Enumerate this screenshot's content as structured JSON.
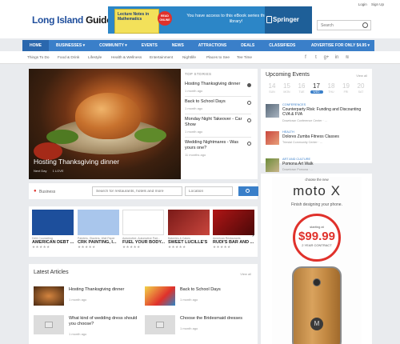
{
  "site": {
    "logo_part1": "Long Island",
    "logo_part2": "Guide"
  },
  "top_links": {
    "login": "Login",
    "signup": "Sign Up"
  },
  "banner": {
    "book_title": "Lecture Notes in Mathematics",
    "badge": "READ ONLINE",
    "message": "You have access to this eBook series through your library!",
    "brand": "Springer"
  },
  "search": {
    "placeholder": "Search"
  },
  "nav": {
    "items": [
      "HOME",
      "BUSINESSES ▾",
      "COMMUNITY ▾",
      "EVENTS",
      "NEWS",
      "ATTRACTIONS",
      "DEALS",
      "CLASSIFIEDS"
    ],
    "right": "ADVERTISE FOR ONLY $4.95 ▾"
  },
  "subnav": {
    "items": [
      "Things To Do",
      "Food & Drink",
      "Lifestyle",
      "Health & Wellness",
      "Entertainment",
      "Nightlife",
      "Places to See",
      "Tee Time"
    ]
  },
  "social": {
    "icons": [
      "f",
      "t",
      "g+",
      "in",
      "rss"
    ]
  },
  "hero": {
    "caption": "Hosting Thanksgiving dinner",
    "meta_date": "Next Day",
    "meta_views": "1 LOVE",
    "stories_label": "TOP STORIES",
    "stories": [
      {
        "title": "Hosting Thanksgiving dinner",
        "date": "1 month ago"
      },
      {
        "title": "Back to School Days",
        "date": "1 month ago"
      },
      {
        "title": "Monday Night Takeover - Car Show",
        "date": "1 month ago"
      },
      {
        "title": "Wedding Nightmares - Was yours one?",
        "date": "11 months ago"
      }
    ]
  },
  "events": {
    "heading": "Upcoming Events",
    "view_all": "View all",
    "dates": [
      {
        "day": "14",
        "wd": "SUN"
      },
      {
        "day": "15",
        "wd": "MON"
      },
      {
        "day": "16",
        "wd": "TUE"
      },
      {
        "day": "17",
        "wd": "WED"
      },
      {
        "day": "18",
        "wd": "THU"
      },
      {
        "day": "19",
        "wd": "FRI"
      },
      {
        "day": "20",
        "wd": "SAT"
      }
    ],
    "items": [
      {
        "category": "CONFERENCES",
        "name": "Counterparty Risk: Funding and Discounting CVA & FVA",
        "location": "Downtown Conference Center · ..."
      },
      {
        "category": "HEALTH",
        "name": "Dolores Zumba Fitness Classes",
        "location": "Triestal Community Center · ..."
      },
      {
        "category": "ART AND CULTURE",
        "name": "Pomona Art Walk",
        "location": "Downtown Pomona · ..."
      }
    ]
  },
  "finder": {
    "label": "Business",
    "query_placeholder": "Search for restaurants, hotels and more",
    "location_placeholder": "Location"
  },
  "businesses": [
    {
      "category": "Debt Counseling",
      "name": "AMERICAN DEBT ...",
      "stars": "★★★★★"
    },
    {
      "category": "Painters, Glaziers, Wall Paper",
      "name": "CRK PAINTING, I...",
      "stars": "★★★★★"
    },
    {
      "category": "Automotive, Automotive Part...",
      "name": "FUEL YOUR BODY...",
      "stars": "★★★★★"
    },
    {
      "category": "Bakeries & Cakes",
      "name": "SWEET LUCILLE'S",
      "stars": "★★★★★"
    },
    {
      "category": "American Restaurants",
      "name": "RUDI'S BAR AND ...",
      "stars": "★★★★★"
    }
  ],
  "latest": {
    "heading": "Latest Articles",
    "view_all": "View all",
    "articles": [
      {
        "title": "Hosting Thanksgiving dinner",
        "date": "1 month ago"
      },
      {
        "title": "Back to School Days",
        "date": "1 month ago"
      },
      {
        "title": "What kind of wedding dress should you choose?",
        "date": "1 month ago"
      },
      {
        "title": "Choose the Bridesmaid dresses",
        "date": "1 month ago"
      }
    ]
  },
  "ad": {
    "tagline": "choose the new",
    "brand": "moto X",
    "sub": "Finish designing your phone.",
    "price_label": "starting at",
    "price": "$99.99",
    "price_suffix": "2 YEAR CONTRACT"
  }
}
